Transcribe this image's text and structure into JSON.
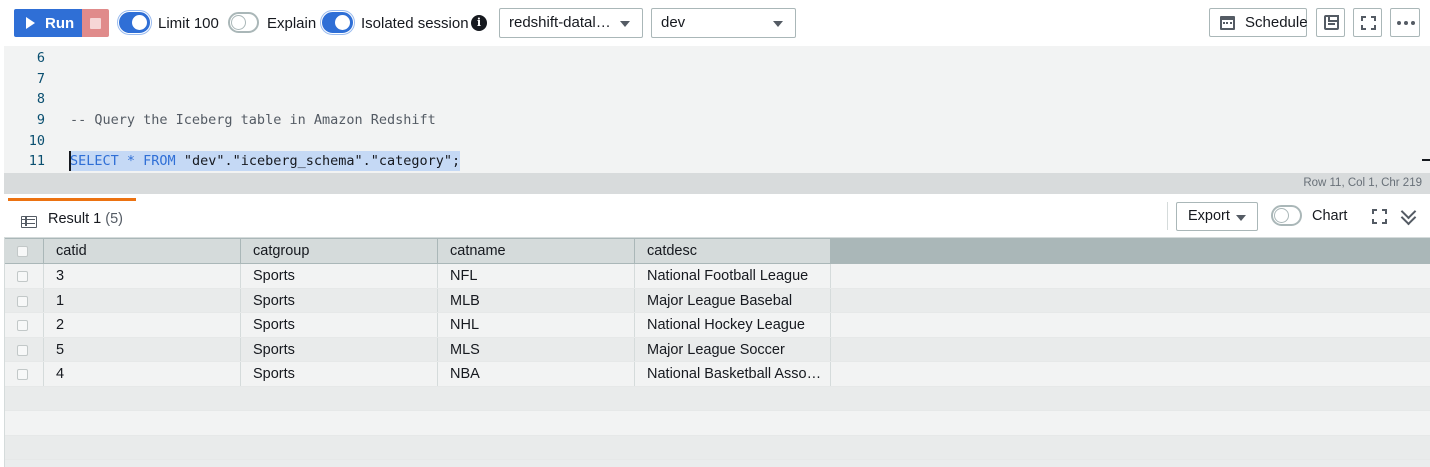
{
  "toolbar": {
    "run_label": "Run",
    "limit_label": "Limit 100",
    "explain_label": "Explain",
    "isolated_label": "Isolated session",
    "connection_value": "redshift-datal…",
    "database_value": "dev",
    "schedule_label": "Schedule",
    "toggles": {
      "limit": true,
      "explain": false,
      "isolated": true
    }
  },
  "editor": {
    "lines": [
      {
        "num": "6",
        "text": ""
      },
      {
        "num": "7",
        "text": ""
      },
      {
        "num": "8",
        "text": ""
      },
      {
        "num": "9",
        "text": "-- Query the Iceberg table in Amazon Redshift"
      },
      {
        "num": "10",
        "text": ""
      },
      {
        "num": "11",
        "kw1": "SELECT",
        "op": " * ",
        "kw2": "FROM",
        "rest": " \"dev\".\"iceberg_schema\".\"category\";"
      }
    ],
    "status": "Row 11,  Col 1,  Chr 219"
  },
  "results": {
    "tab_label": "Result 1",
    "tab_count": "(5)",
    "export_label": "Export",
    "chart_label": "Chart",
    "chart_toggle": false,
    "columns": [
      "catid",
      "catgroup",
      "catname",
      "catdesc"
    ],
    "rows": [
      [
        "3",
        "Sports",
        "NFL",
        "National Football League"
      ],
      [
        "1",
        "Sports",
        "MLB",
        "Major League Basebal"
      ],
      [
        "2",
        "Sports",
        "NHL",
        "National Hockey League"
      ],
      [
        "5",
        "Sports",
        "MLS",
        "Major League Soccer"
      ],
      [
        "4",
        "Sports",
        "NBA",
        "National Basketball Asso…"
      ]
    ]
  },
  "colors": {
    "primary": "#2f6fd6",
    "stop": "#e08b8b",
    "tab_accent": "#ec7211",
    "selection": "#c5d9f5"
  },
  "icons": [
    "play-icon",
    "stop-icon",
    "info-icon",
    "calendar-icon",
    "save-icon",
    "fullscreen-icon",
    "more-icon",
    "table-icon",
    "chevron-down-icon"
  ]
}
